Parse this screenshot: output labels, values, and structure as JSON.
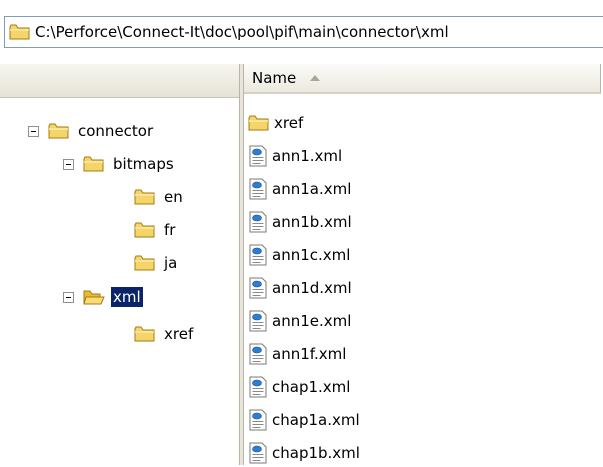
{
  "address_bar": {
    "path": "C:\\Perforce\\Connect-It\\doc\\pool\\pif\\main\\connector\\xml"
  },
  "header": {
    "name_column": "Name"
  },
  "tree": {
    "items": [
      {
        "label": "connector"
      },
      {
        "label": "bitmaps"
      },
      {
        "label": "en"
      },
      {
        "label": "fr"
      },
      {
        "label": "ja"
      },
      {
        "label": "xml"
      },
      {
        "label": "xref"
      }
    ]
  },
  "files": {
    "items": [
      {
        "name": "xref",
        "icon": "folder-icon"
      },
      {
        "name": "ann1.xml",
        "icon": "xml-file-icon"
      },
      {
        "name": "ann1a.xml",
        "icon": "xml-file-icon"
      },
      {
        "name": "ann1b.xml",
        "icon": "xml-file-icon"
      },
      {
        "name": "ann1c.xml",
        "icon": "xml-file-icon"
      },
      {
        "name": "ann1d.xml",
        "icon": "xml-file-icon"
      },
      {
        "name": "ann1e.xml",
        "icon": "xml-file-icon"
      },
      {
        "name": "ann1f.xml",
        "icon": "xml-file-icon"
      },
      {
        "name": "chap1.xml",
        "icon": "xml-file-icon"
      },
      {
        "name": "chap1a.xml",
        "icon": "xml-file-icon"
      },
      {
        "name": "chap1b.xml",
        "icon": "xml-file-icon"
      }
    ]
  },
  "colors": {
    "selection": "#0a246a",
    "folder": "#f5d46a"
  }
}
